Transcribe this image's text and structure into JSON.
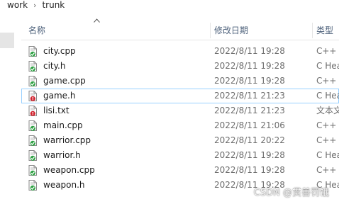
{
  "breadcrumb": {
    "items": [
      "work",
      "trunk"
    ],
    "separator": "›"
  },
  "header": {
    "name_label": "名称",
    "modified_label": "修改日期",
    "type_label": "类型"
  },
  "files": [
    {
      "name": "city.cpp",
      "modified": "2022/8/11 19:28",
      "type": "C++ 源",
      "status": "ok"
    },
    {
      "name": "city.h",
      "modified": "2022/8/11 19:28",
      "type": "C Hea",
      "status": "ok"
    },
    {
      "name": "game.cpp",
      "modified": "2022/8/11 19:28",
      "type": "C++ 源",
      "status": "ok"
    },
    {
      "name": "game.h",
      "modified": "2022/8/11 21:23",
      "type": "C Hea",
      "status": "modified",
      "focused": true
    },
    {
      "name": "lisi.txt",
      "modified": "2022/8/11 21:23",
      "type": "文本文",
      "status": "modified"
    },
    {
      "name": "main.cpp",
      "modified": "2022/8/11 21:06",
      "type": "C++ 源",
      "status": "ok"
    },
    {
      "name": "warrior.cpp",
      "modified": "2022/8/11 20:22",
      "type": "C++ 源",
      "status": "ok"
    },
    {
      "name": "warrior.h",
      "modified": "2022/8/11 19:28",
      "type": "C Hea",
      "status": "ok"
    },
    {
      "name": "weapon.cpp",
      "modified": "2022/8/11 19:28",
      "type": "C++ 源",
      "status": "ok"
    },
    {
      "name": "weapon.h",
      "modified": "2022/8/11 19:28",
      "type": "C Hea",
      "status": "ok"
    }
  ],
  "watermark": "CSDN @贯善罚饿",
  "colors": {
    "ok_overlay": "#2ea043",
    "modified_overlay": "#d1242f",
    "header_text": "#4c607a"
  },
  "icons": {
    "ok": "check-overlay-icon",
    "modified": "exclamation-overlay-icon",
    "sort": "sort-ascending-icon"
  }
}
